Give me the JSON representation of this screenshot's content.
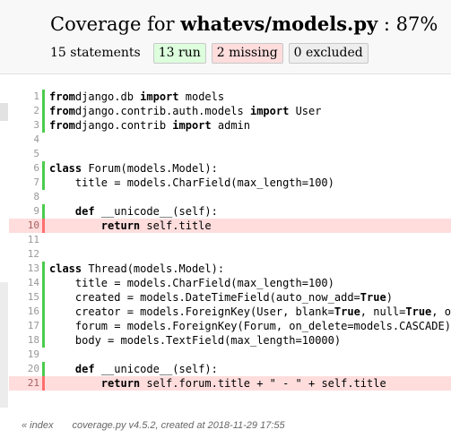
{
  "header": {
    "title_prefix": "Coverage for ",
    "filename": "whatevs/models.py",
    "title_sep": " : ",
    "percent": "87%",
    "statements": "15 statements",
    "run_label": "13 run",
    "missing_label": "2 missing",
    "excluded_label": "0 excluded"
  },
  "lines": [
    {
      "n": "1",
      "s": "run",
      "t": [
        [
          "k",
          "from"
        ],
        [
          "",
          "django.db "
        ],
        [
          "k",
          "import"
        ],
        [
          "",
          " models"
        ]
      ]
    },
    {
      "n": "2",
      "s": "run",
      "t": [
        [
          "k",
          "from"
        ],
        [
          "",
          "django.contrib.auth.models "
        ],
        [
          "k",
          "import"
        ],
        [
          "",
          " User"
        ]
      ]
    },
    {
      "n": "3",
      "s": "run",
      "t": [
        [
          "k",
          "from"
        ],
        [
          "",
          "django.contrib "
        ],
        [
          "k",
          "import"
        ],
        [
          "",
          " admin"
        ]
      ]
    },
    {
      "n": "4",
      "s": "",
      "t": []
    },
    {
      "n": "5",
      "s": "",
      "t": []
    },
    {
      "n": "6",
      "s": "run",
      "t": [
        [
          "k",
          "class"
        ],
        [
          "",
          " Forum(models.Model):"
        ]
      ]
    },
    {
      "n": "7",
      "s": "run",
      "t": [
        [
          "",
          "    title = models.CharField(max_length=100)"
        ]
      ]
    },
    {
      "n": "8",
      "s": "",
      "t": []
    },
    {
      "n": "9",
      "s": "run",
      "t": [
        [
          "",
          "    "
        ],
        [
          "k",
          "def"
        ],
        [
          "",
          " __unicode__(self):"
        ]
      ]
    },
    {
      "n": "10",
      "s": "mis",
      "t": [
        [
          "",
          "        "
        ],
        [
          "k",
          "return"
        ],
        [
          "",
          " self.title"
        ]
      ]
    },
    {
      "n": "11",
      "s": "",
      "t": []
    },
    {
      "n": "12",
      "s": "",
      "t": []
    },
    {
      "n": "13",
      "s": "run",
      "t": [
        [
          "k",
          "class"
        ],
        [
          "",
          " Thread(models.Model):"
        ]
      ]
    },
    {
      "n": "14",
      "s": "run",
      "t": [
        [
          "",
          "    title = models.CharField(max_length=100)"
        ]
      ]
    },
    {
      "n": "15",
      "s": "run",
      "t": [
        [
          "",
          "    created = models.DateTimeField(auto_now_add="
        ],
        [
          "k",
          "True"
        ],
        [
          "",
          ")"
        ]
      ]
    },
    {
      "n": "16",
      "s": "run",
      "t": [
        [
          "",
          "    creator = models.ForeignKey(User, blank="
        ],
        [
          "k",
          "True"
        ],
        [
          "",
          ", null="
        ],
        [
          "k",
          "True"
        ],
        [
          "",
          ", o"
        ]
      ]
    },
    {
      "n": "17",
      "s": "run",
      "t": [
        [
          "",
          "    forum = models.ForeignKey(Forum, on_delete=models.CASCADE)"
        ]
      ]
    },
    {
      "n": "18",
      "s": "run",
      "t": [
        [
          "",
          "    body = models.TextField(max_length=10000)"
        ]
      ]
    },
    {
      "n": "19",
      "s": "",
      "t": []
    },
    {
      "n": "20",
      "s": "run",
      "t": [
        [
          "",
          "    "
        ],
        [
          "k",
          "def"
        ],
        [
          "",
          " __unicode__(self):"
        ]
      ]
    },
    {
      "n": "21",
      "s": "mis",
      "t": [
        [
          "",
          "        "
        ],
        [
          "k",
          "return"
        ],
        [
          "",
          " self.forum.title + \" - \" + self.title"
        ]
      ]
    }
  ],
  "footer": {
    "index_link": "« index",
    "info": "coverage.py v4.5.2, created at 2018-11-29 17:55"
  }
}
